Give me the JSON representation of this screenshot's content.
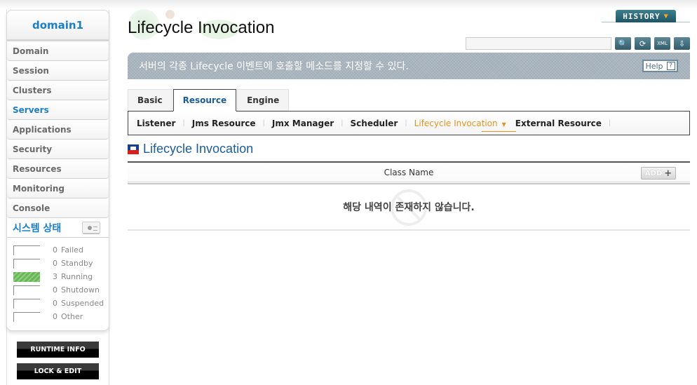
{
  "sidebar": {
    "domain": "domain1",
    "nav": [
      {
        "label": "Domain",
        "active": false
      },
      {
        "label": "Session",
        "active": false
      },
      {
        "label": "Clusters",
        "active": false
      },
      {
        "label": "Servers",
        "active": true
      },
      {
        "label": "Applications",
        "active": false
      },
      {
        "label": "Security",
        "active": false
      },
      {
        "label": "Resources",
        "active": false
      },
      {
        "label": "Monitoring",
        "active": false
      },
      {
        "label": "Console",
        "active": false
      }
    ],
    "system_status": {
      "title": "시스템 상태",
      "rows": [
        {
          "count": "0",
          "label": "Failed"
        },
        {
          "count": "0",
          "label": "Standby"
        },
        {
          "count": "3",
          "label": "Running"
        },
        {
          "count": "0",
          "label": "Shutdown"
        },
        {
          "count": "0",
          "label": "Suspended"
        },
        {
          "count": "0",
          "label": "Other"
        }
      ]
    },
    "runtime_info_label": "RUNTIME INFO",
    "lock_edit_label": "LOCK & EDIT"
  },
  "header": {
    "title": "Lifecycle Invocation",
    "history_label": "HISTORY",
    "search": {
      "value": "",
      "placeholder": ""
    },
    "description": "서버의 각종 Lifecycle 이벤트에 호출할 메소드를 지정할 수 있다.",
    "help_label": "Help",
    "help_icon": "?"
  },
  "tabs": [
    {
      "label": "Basic",
      "active": false
    },
    {
      "label": "Resource",
      "active": true
    },
    {
      "label": "Engine",
      "active": false
    }
  ],
  "subnav": [
    {
      "label": "Listener",
      "active": false
    },
    {
      "label": "Jms Resource",
      "active": false
    },
    {
      "label": "Jmx Manager",
      "active": false
    },
    {
      "label": "Scheduler",
      "active": false
    },
    {
      "label": "Lifecycle Invocation",
      "active": true
    },
    {
      "label": "External Resource",
      "active": false
    }
  ],
  "section": {
    "title": "Lifecycle Invocation",
    "table": {
      "column": "Class Name",
      "add_label": "ADD",
      "empty_message": "해당 내역이 존재하지 않습니다."
    }
  },
  "colors": {
    "accent_blue": "#1a7fc8",
    "active_subnav": "#e8941c",
    "running_green": "#6bb55a"
  }
}
